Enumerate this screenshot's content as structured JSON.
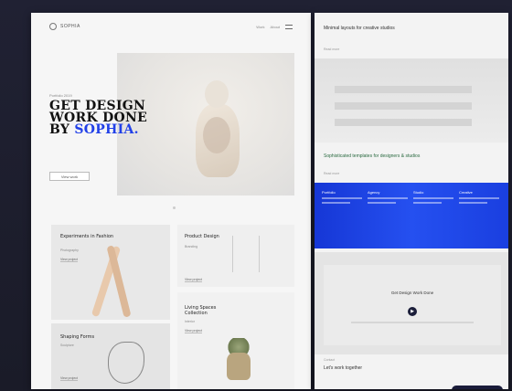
{
  "left_page": {
    "nav": {
      "logo": "SOPHIA",
      "links": [
        "Work",
        "About"
      ]
    },
    "hero": {
      "kicker": "Portfolio 2019",
      "title_line1": "GET DESIGN",
      "title_line2": "WORK DONE",
      "title_line3_prefix": "BY ",
      "title_accent": "SOPHIA.",
      "cta": "View work"
    },
    "cards": [
      {
        "title": "Experiments in Fashion",
        "sub": "Photography",
        "link": "View project"
      },
      {
        "title": "Product Design",
        "sub": "Branding",
        "link": "View project"
      },
      {
        "title": "Shaping Forms",
        "sub": "Sculpture",
        "link": "View project"
      },
      {
        "title": "Living Spaces Collection",
        "sub": "Interior",
        "link": "View project"
      }
    ]
  },
  "right_page": {
    "header": "Minimal layouts for creative studios",
    "header_sub": "Read more",
    "section_title": "Sophisticated templates for designers & studios",
    "section_sub": "Read more",
    "blue_columns": [
      "Portfolio",
      "Agency",
      "Studio",
      "Creative"
    ],
    "box_title": "Get Design Work Done",
    "box_button": "▶",
    "footer_kicker": "Contact",
    "footer_title": "Let's work together"
  }
}
